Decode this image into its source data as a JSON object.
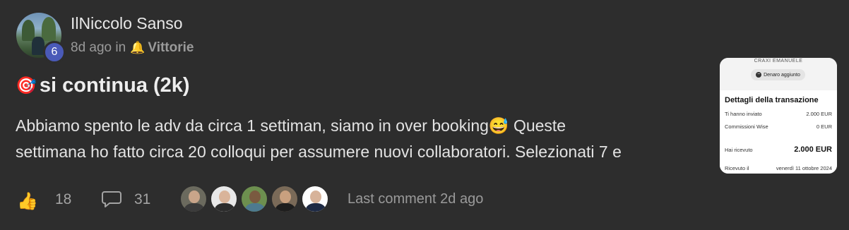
{
  "post": {
    "author": "IlNiccolo Sanso",
    "level": "6",
    "time_ago": "8d ago",
    "in_label": "in",
    "category_icon": "🔔",
    "category": "Vittorie",
    "title_emoji": "🎯",
    "title": "si continua (2k)",
    "body_line1": "Abbiamo spento le adv da circa 1 settiman, siamo in over booking😅 Queste",
    "body_line2": "settimana ho fatto circa 20 colloqui per assumere nuovi collaboratori. Selezionati 7 e"
  },
  "attachment": {
    "name": "CRAXI EMANUELE",
    "pill_label": "Denaro aggiunto",
    "heading": "Dettagli della transazione",
    "rows": [
      {
        "label": "Ti hanno inviato",
        "value": "2.000 EUR"
      },
      {
        "label": "Commissioni Wise",
        "value": "0 EUR"
      },
      {
        "label": "Hai ricevuto",
        "value": "2.000 EUR"
      },
      {
        "label": "Ricevuto il",
        "value": "venerdì 11 ottobre 2024"
      }
    ]
  },
  "footer": {
    "like_icon": "thumbs-up",
    "likes": "18",
    "comment_icon": "speech-bubble",
    "comments": "31",
    "commenters": [
      {
        "bg": "#6b6a5e",
        "skin": "#c9a58a",
        "shirt": "#3b3b3b"
      },
      {
        "bg": "#e8e8e8",
        "skin": "#d9b49a",
        "shirt": "#2c2c2c"
      },
      {
        "bg": "#6d8f4f",
        "skin": "#7a5a40",
        "shirt": "#4d7a8f"
      },
      {
        "bg": "#7a6a58",
        "skin": "#c9a07f",
        "shirt": "#1e1e1e"
      },
      {
        "bg": "#ffffff",
        "skin": "#d7b39a",
        "shirt": "#1e2a44"
      }
    ],
    "last_comment": "Last comment 2d ago"
  }
}
